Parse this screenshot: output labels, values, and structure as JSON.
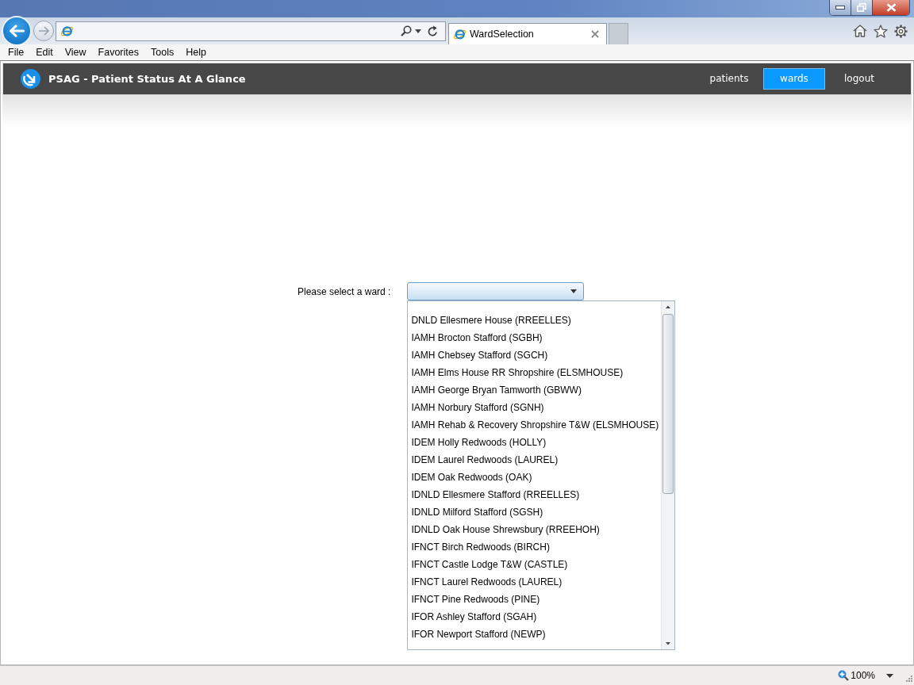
{
  "browser": {
    "tabs": [
      {
        "title": "WardSelection",
        "selected": true
      }
    ],
    "menu": [
      "File",
      "Edit",
      "View",
      "Favorites",
      "Tools",
      "Help"
    ],
    "zoom": "100%"
  },
  "app": {
    "title": "PSAG - Patient Status At A Glance",
    "nav": [
      {
        "label": "patients",
        "selected": false
      },
      {
        "label": "wards",
        "selected": true
      },
      {
        "label": "logout",
        "selected": false
      }
    ]
  },
  "ward_picker": {
    "label": "Please select a ward :",
    "expanded": true,
    "options": [
      {
        "label": "DNLD Ellesmere House (RREELLES)",
        "selected": false
      },
      {
        "label": "IAMH Brocton Stafford (SGBH)",
        "selected": false
      },
      {
        "label": "IAMH Chebsey Stafford (SGCH)",
        "selected": false
      },
      {
        "label": "IAMH Elms House RR Shropshire (ELSMHOUSE)",
        "selected": false
      },
      {
        "label": "IAMH George Bryan Tamworth (GBWW)",
        "selected": false
      },
      {
        "label": "IAMH Norbury Stafford (SGNH)",
        "selected": false
      },
      {
        "label": "IAMH Rehab & Recovery Shropshire T&W (ELSMHOUSE)",
        "selected": false
      },
      {
        "label": "IDEM Holly Redwoods (HOLLY)",
        "selected": false
      },
      {
        "label": "IDEM Laurel Redwoods (LAUREL)",
        "selected": false
      },
      {
        "label": "IDEM Oak Redwoods (OAK)",
        "selected": false
      },
      {
        "label": "IDNLD Ellesmere Stafford (RREELLES)",
        "selected": false
      },
      {
        "label": "IDNLD Milford Stafford (SGSH)",
        "selected": false
      },
      {
        "label": "IDNLD Oak House Shrewsbury (RREEHOH)",
        "selected": false
      },
      {
        "label": "IFNCT Birch Redwoods (BIRCH)",
        "selected": false
      },
      {
        "label": "IFNCT Castle Lodge T&W (CASTLE)",
        "selected": false
      },
      {
        "label": "IFNCT Laurel Redwoods (LAUREL)",
        "selected": false
      },
      {
        "label": "IFNCT Pine Redwoods (PINE)",
        "selected": false
      },
      {
        "label": "IFOR Ashley Stafford (SGAH)",
        "selected": false
      },
      {
        "label": "IFOR Newport Stafford (NEWP)",
        "selected": false
      }
    ]
  }
}
